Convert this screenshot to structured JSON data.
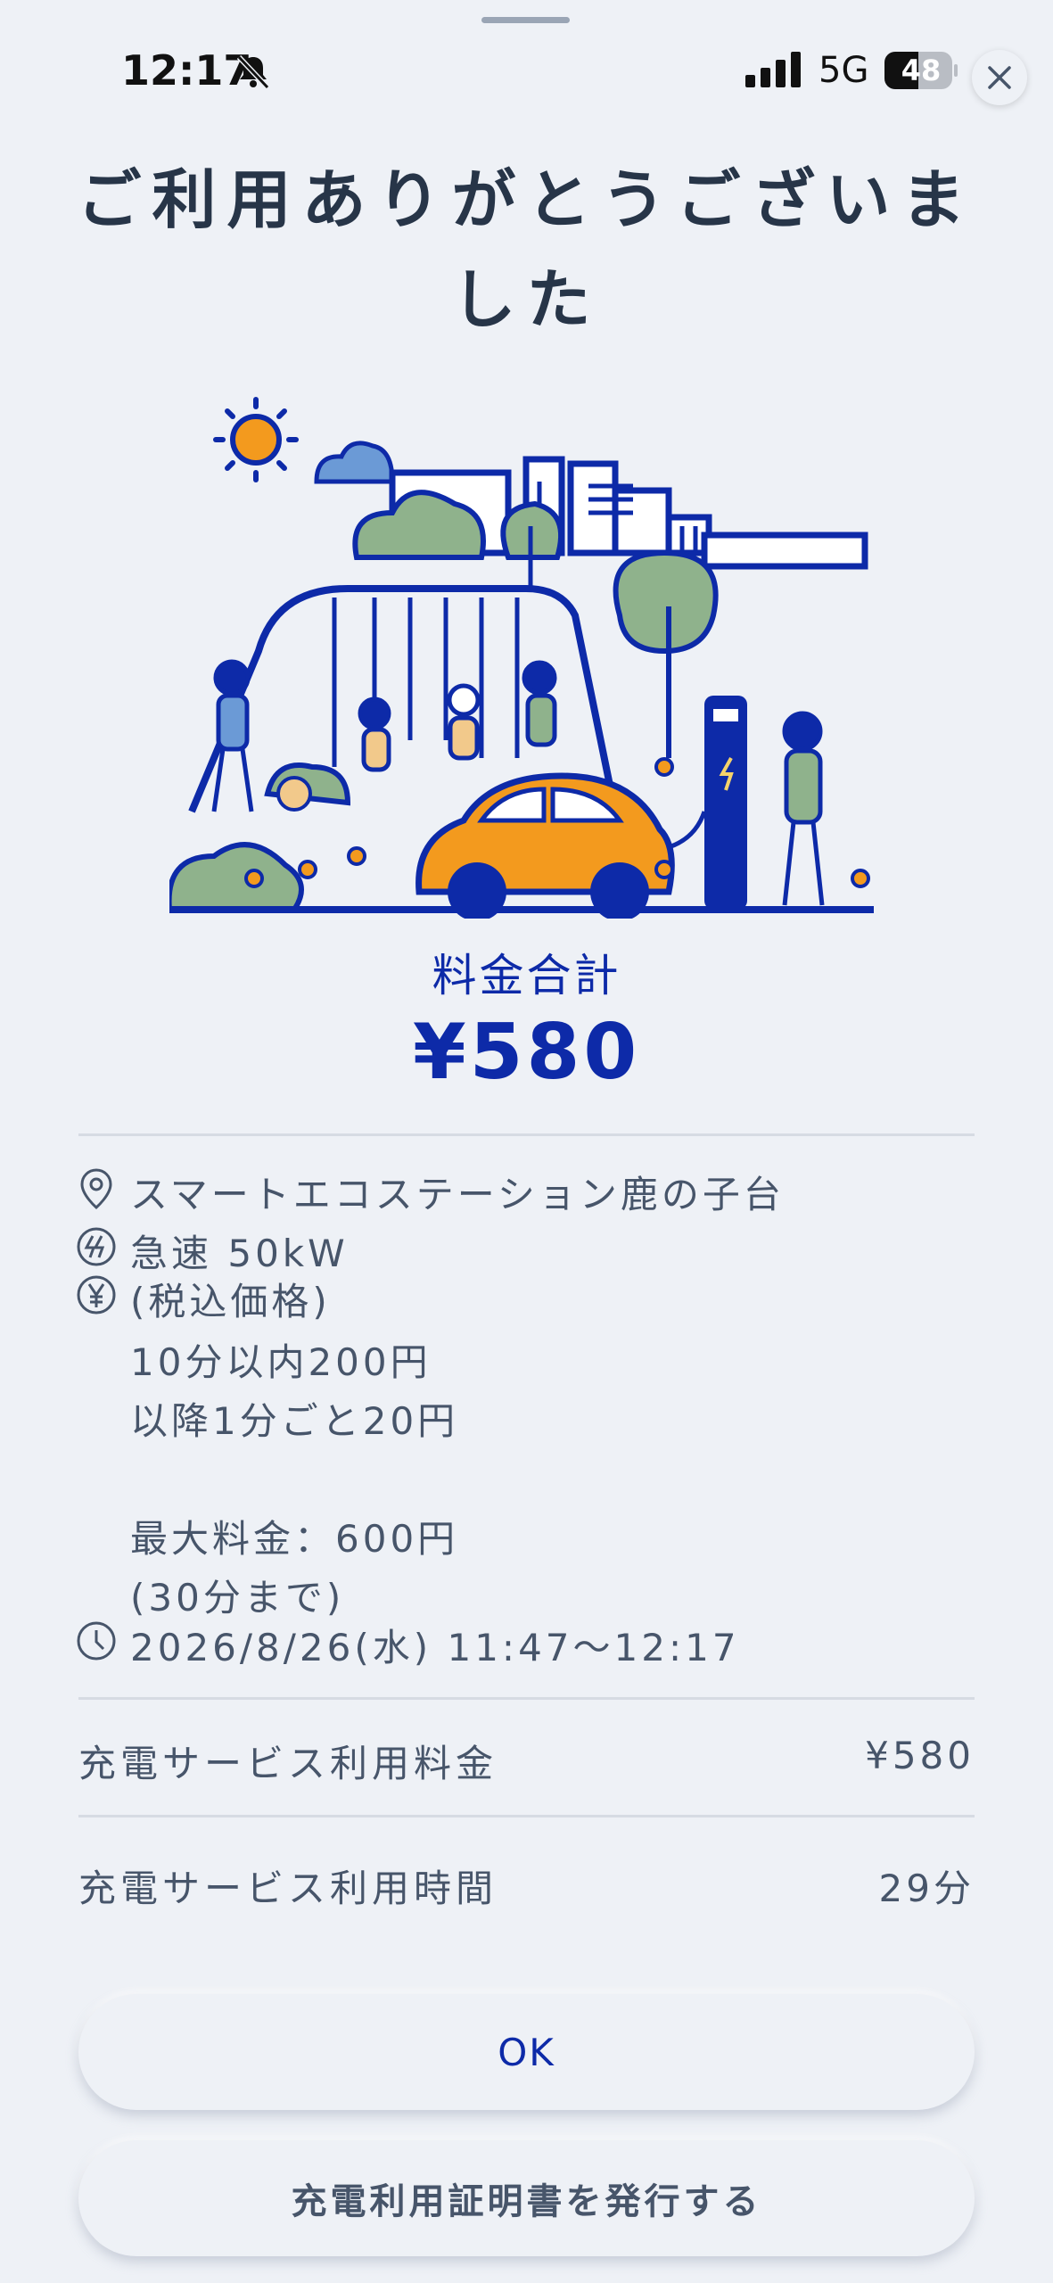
{
  "status_bar": {
    "time": "12:17",
    "network": "5G",
    "battery": "48"
  },
  "title": "ご利用ありがとうございました",
  "total": {
    "label": "料金合計",
    "amount": "¥580"
  },
  "details": {
    "station": "スマートエコステーション鹿の子台",
    "charger": "急速 50kW",
    "price_header": "(税込価格)",
    "price_line1": "10分以内200円",
    "price_line2": "以降1分ごと20円",
    "price_max": "最大料金：600円",
    "price_max_note": "(30分まで)",
    "datetime": "2026/8/26(水) 11:47～12:17"
  },
  "fees": [
    {
      "label": "充電サービス利用料金",
      "value": "¥580"
    },
    {
      "label": "充電サービス利用時間",
      "value": "29分"
    }
  ],
  "buttons": {
    "ok": "OK",
    "certificate": "充電利用証明書を発行する"
  },
  "colors": {
    "accent": "#0d2aa8",
    "orange": "#f39a1e",
    "green": "#8fb28c",
    "background": "#eef1f6"
  }
}
